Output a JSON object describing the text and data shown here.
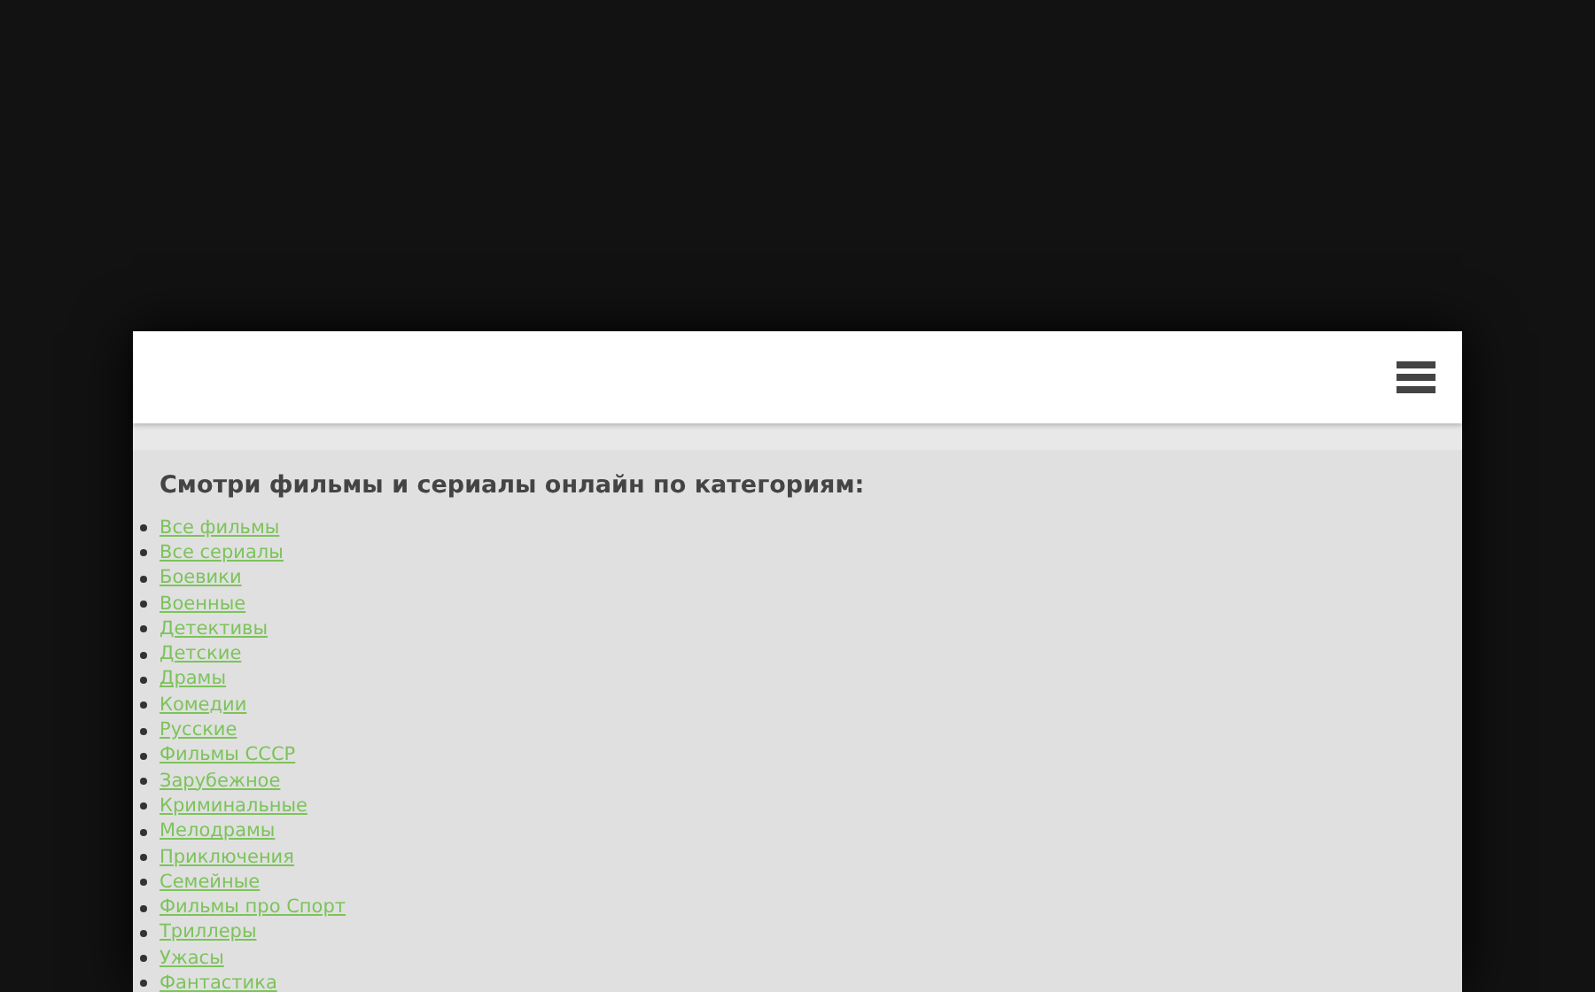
{
  "heading": "Смотри фильмы и сериалы онлайн по категориям:",
  "categories": [
    "Все фильмы",
    "Все сериалы",
    "Боевики",
    "Военные",
    "Детективы",
    "Детские",
    "Драмы",
    "Комедии",
    "Русские",
    "Фильмы СССР",
    "Зарубежное",
    "Криминальные",
    "Мелодрамы",
    "Приключения",
    "Семейные",
    "Фильмы про Спорт",
    "Триллеры",
    "Ужасы",
    "Фантастика"
  ]
}
